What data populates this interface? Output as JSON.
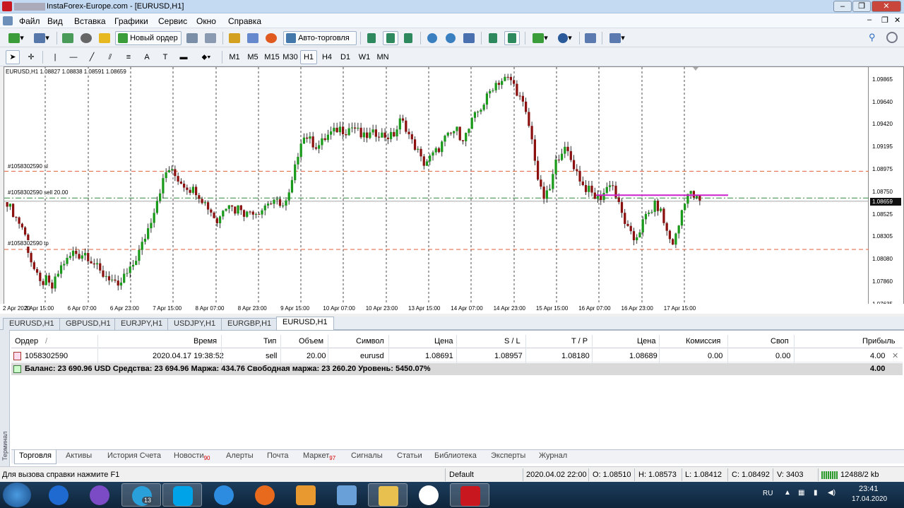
{
  "window": {
    "title": "InstaForex-Europe.com - [EURUSD,H1]",
    "min": "–",
    "max": "❐",
    "close": "✕"
  },
  "menu": [
    "Файл",
    "Вид",
    "Вставка",
    "Графики",
    "Сервис",
    "Окно",
    "Справка"
  ],
  "toolbar": {
    "new_order": "Новый ордер",
    "auto_trading": "Авто-торговля"
  },
  "timeframes": [
    "M1",
    "M5",
    "M15",
    "M30",
    "H1",
    "H4",
    "D1",
    "W1",
    "MN"
  ],
  "active_timeframe": "H1",
  "chart_info": "EURUSD,H1  1.08827 1.08838 1.08591 1.08659",
  "order_lines": {
    "sl": "#1058302590 sl",
    "sell": "#1058302590 sell 20.00",
    "tp": "#1058302590 tp"
  },
  "chart_data": {
    "type": "candlestick",
    "symbol": "EURUSD",
    "timeframe": "H1",
    "x_ticks": [
      "2 Apr 2020",
      "3 Apr 15:00",
      "6 Apr 07:00",
      "6 Apr 23:00",
      "7 Apr 15:00",
      "8 Apr 07:00",
      "8 Apr 23:00",
      "9 Apr 15:00",
      "10 Apr 07:00",
      "10 Apr 23:00",
      "13 Apr 15:00",
      "14 Apr 07:00",
      "14 Apr 23:00",
      "15 Apr 15:00",
      "16 Apr 07:00",
      "16 Apr 23:00",
      "17 Apr 15:00"
    ],
    "y_ticks": [
      "1.09865",
      "1.09640",
      "1.09420",
      "1.09195",
      "1.08975",
      "1.08750",
      "1.08525",
      "1.08305",
      "1.08080",
      "1.07860",
      "1.07635"
    ],
    "ylim": [
      1.0759,
      1.0995
    ],
    "current_price": "1.08659",
    "current_price_value": 1.08659,
    "levels": {
      "sl": 1.08957,
      "sell": 1.08691,
      "tp": 1.0818,
      "bid": 1.08659
    },
    "close_path": [
      1.0865,
      1.0855,
      1.0846,
      1.0838,
      1.0812,
      1.0796,
      1.0783,
      1.0788,
      1.0778,
      1.0792,
      1.0804,
      1.0808,
      1.0816,
      1.0812,
      1.0815,
      1.0808,
      1.0802,
      1.0793,
      1.0792,
      1.0787,
      1.0778,
      1.0791,
      1.0795,
      1.0806,
      1.0818,
      1.0832,
      1.0848,
      1.0867,
      1.0884,
      1.0899,
      1.0893,
      1.0887,
      1.0882,
      1.0878,
      1.0877,
      1.0869,
      1.0862,
      1.0854,
      1.0844,
      1.086,
      1.0865,
      1.0856,
      1.0862,
      1.0852,
      1.0857,
      1.0855,
      1.0858,
      1.0865,
      1.0863,
      1.0866,
      1.086,
      1.0874,
      1.09,
      1.0927,
      1.0931,
      1.0924,
      1.092,
      1.0926,
      1.0932,
      1.0935,
      1.0939,
      1.0935,
      1.094,
      1.0938,
      1.0929,
      1.0931,
      1.0933,
      1.0934,
      1.0931,
      1.093,
      1.0933,
      1.0947,
      1.0939,
      1.0925,
      1.0917,
      1.0903,
      1.0907,
      1.0913,
      1.0919,
      1.0928,
      1.0932,
      1.0938,
      1.0928,
      1.0933,
      1.0947,
      1.0955,
      1.0963,
      1.0974,
      1.0983,
      1.0985,
      1.0988,
      1.0986,
      1.0975,
      1.0963,
      1.0945,
      1.0918,
      1.088,
      1.0868,
      1.0879,
      1.0904,
      1.0917,
      1.0916,
      1.0904,
      1.0893,
      1.088,
      1.0877,
      1.087,
      1.0869,
      1.0877,
      1.0887,
      1.0868,
      1.0852,
      1.0838,
      1.0827,
      1.0835,
      1.0849,
      1.0855,
      1.0863,
      1.0855,
      1.0836,
      1.0823,
      1.0836,
      1.0864,
      1.0875,
      1.087,
      1.0866
    ]
  },
  "chart_tabs": [
    "EURUSD,H1",
    "GBPUSD,H1",
    "EURJPY,H1",
    "USDJPY,H1",
    "EURGBP,H1",
    "EURUSD,H1"
  ],
  "terminal": {
    "side_label": "Терминал",
    "headers": [
      "Ордер",
      "/",
      "Время",
      "Тип",
      "Объем",
      "Символ",
      "Цена",
      "S / L",
      "T / P",
      "Цена",
      "Комиссия",
      "Своп",
      "Прибыль"
    ],
    "order": {
      "ticket": "1058302590",
      "time": "2020.04.17 19:38:52",
      "type": "sell",
      "volume": "20.00",
      "symbol": "eurusd",
      "price": "1.08691",
      "sl": "1.08957",
      "tp": "1.08180",
      "cur_price": "1.08689",
      "commission": "0.00",
      "swap": "0.00",
      "profit": "4.00"
    },
    "balance_text": "Баланс: 23 690.96 USD  Средства: 23 694.96  Маржа: 434.76  Свободная маржа: 23 260.20  Уровень: 5450.07%",
    "balance_profit": "4.00",
    "tabs": [
      "Торговля",
      "Активы",
      "История Счета",
      "Новости",
      "Алерты",
      "Почта",
      "Маркет",
      "Сигналы",
      "Статьи",
      "Библиотека",
      "Эксперты",
      "Журнал"
    ],
    "news_badge": "90",
    "market_badge": "97"
  },
  "status": {
    "help": "Для вызова справки нажмите F1",
    "profile": "Default",
    "time": "2020.04.02 22:00",
    "open": "O: 1.08510",
    "high": "H: 1.08573",
    "low": "L: 1.08412",
    "close": "C: 1.08492",
    "volume": "V: 3403",
    "traffic": "12488/2 kb"
  },
  "tray": {
    "lang": "RU",
    "time": "23:41",
    "date": "17.04.2020",
    "telegram_badge": "13"
  },
  "colors": {
    "bull": "#1a9a1a",
    "bear": "#8b1010",
    "sl_tp": "#e0603a",
    "sell": "#2a8a3a",
    "magenta": "#cc22cc"
  }
}
